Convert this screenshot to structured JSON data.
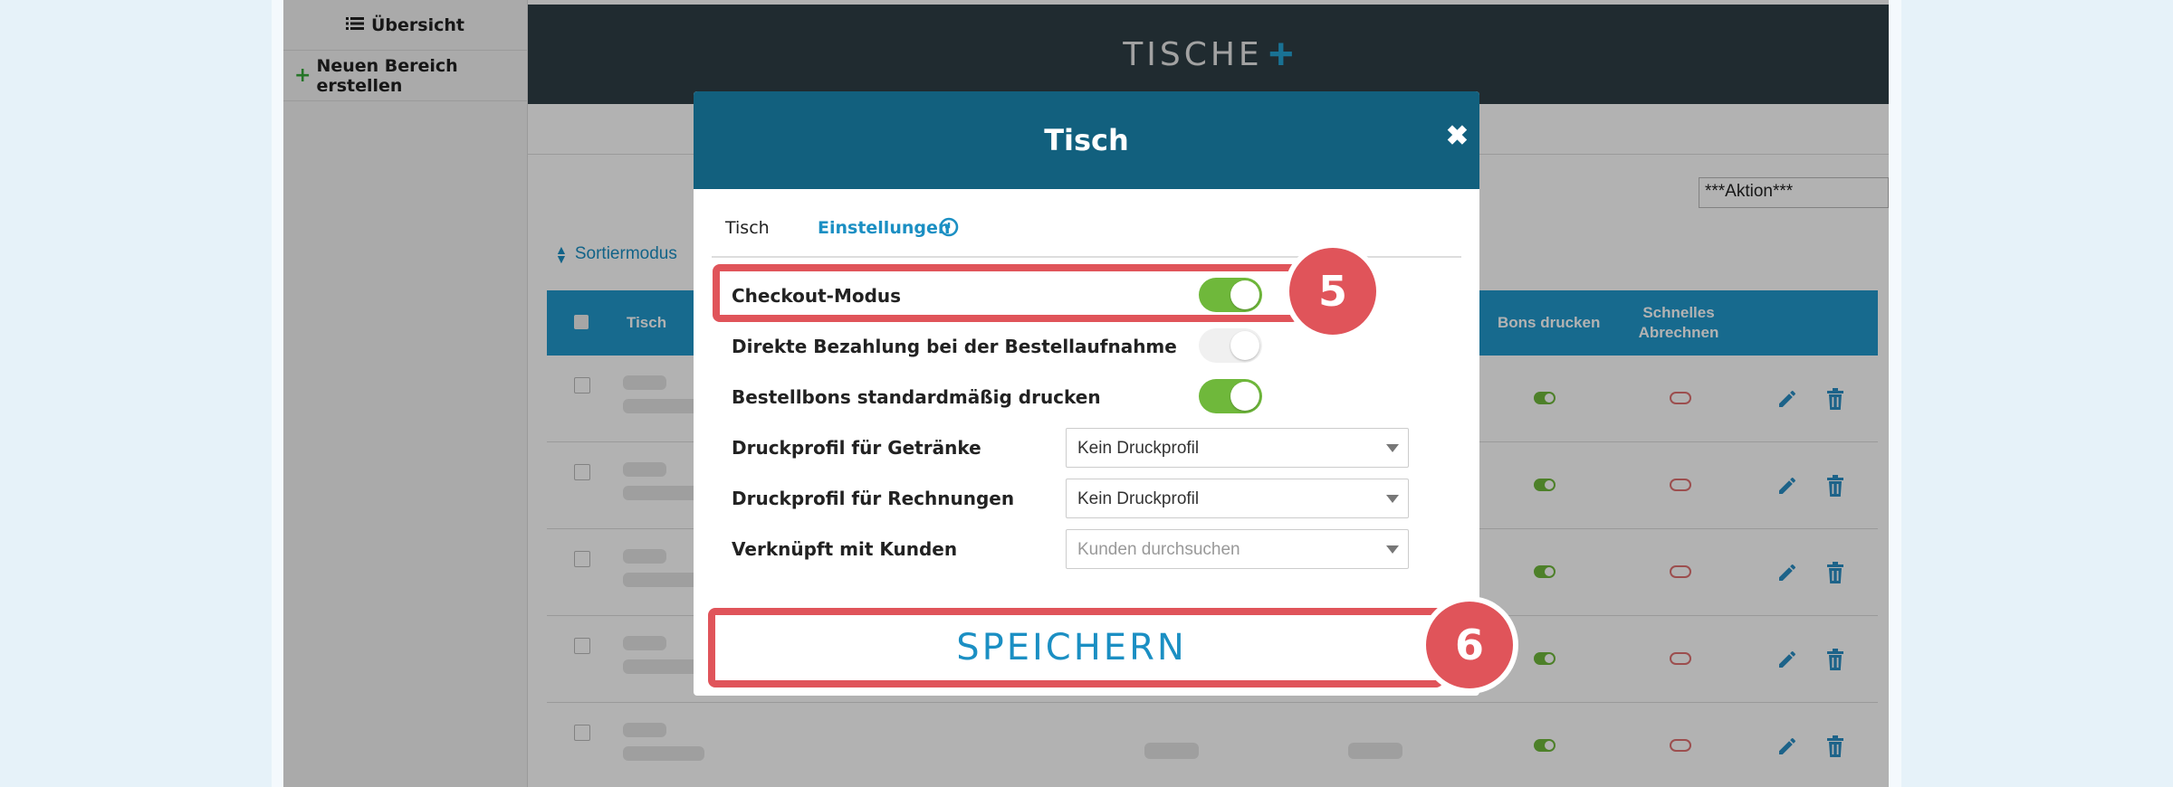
{
  "sidebar": {
    "overview_label": "Übersicht",
    "new_area_label": "Neuen Bereich erstellen"
  },
  "topbar": {
    "title": "TISCHE"
  },
  "toolbar": {
    "action_select": "***Aktion***",
    "sort_mode": "Sortiermodus"
  },
  "table": {
    "headers": {
      "tisch": "Tisch",
      "bons_drucken": "Bons drucken",
      "schnelles_abrechnen_1": "Schnelles",
      "schnelles_abrechnen_2": "Abrechnen"
    }
  },
  "modal": {
    "title": "Tisch",
    "close_glyph": "✖",
    "tabs": {
      "tisch": "Tisch",
      "einstellungen": "Einstellungen"
    },
    "fields": {
      "checkout_mode": {
        "label": "Checkout-Modus",
        "on": true
      },
      "direct_payment": {
        "label": "Direkte Bezahlung bei der Bestellaufnahme",
        "on": false
      },
      "print_orders_default": {
        "label": "Bestellbons standardmäßig drucken",
        "on": true
      },
      "print_profile_drinks": {
        "label": "Druckprofil für Getränke",
        "value": "Kein Druckprofil"
      },
      "print_profile_invoices": {
        "label": "Druckprofil für Rechnungen",
        "value": "Kein Druckprofil"
      },
      "linked_customer": {
        "label": "Verknüpft mit Kunden",
        "placeholder": "Kunden durchsuchen"
      }
    },
    "save_label": "SPEICHERN"
  },
  "annotations": {
    "step5": "5",
    "step6": "6",
    "color": "#e0545a"
  },
  "colors": {
    "header": "#12607e",
    "accent": "#1b8fc3",
    "toggle_on": "#6fb83b",
    "topbar": "#2f3e45",
    "table_header": "#2299cc"
  }
}
